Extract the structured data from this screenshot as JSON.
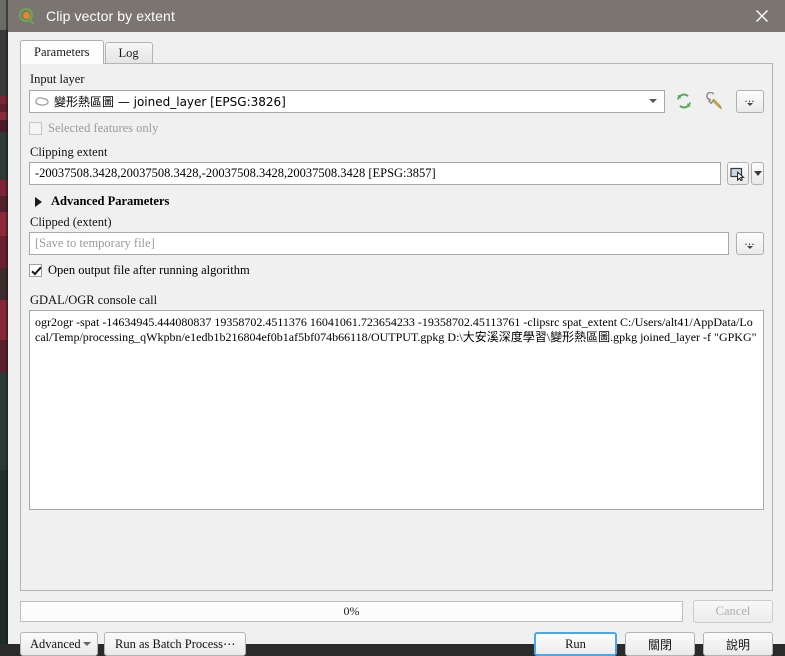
{
  "window": {
    "title": "Clip vector by extent",
    "icon": "qgis-logo-icon",
    "close_label": "✕"
  },
  "tabs": [
    {
      "label": "Parameters",
      "active": true
    },
    {
      "label": "Log",
      "active": false
    }
  ],
  "parameters": {
    "input_layer": {
      "label": "Input layer",
      "value": "變形熱區圖 — joined_layer [EPSG:3826]",
      "layer_icon": "polygon-layer-icon",
      "iterate_icon": "iterate-over-features-icon",
      "expression_icon": "data-defined-override-icon",
      "more_icon": "more-options-icon"
    },
    "selected_features_only": {
      "label": "Selected features only",
      "checked": false,
      "enabled": false
    },
    "clipping_extent": {
      "label": "Clipping extent",
      "value": "-20037508.3428,20037508.3428,-20037508.3428,20037508.3428 [EPSG:3857]",
      "select_extent_icon": "select-extent-on-canvas-icon",
      "dropdown_icon": "chevron-down-icon"
    },
    "advanced_parameters": {
      "label": "Advanced Parameters",
      "expanded": false,
      "toggle_icon": "chevron-right-icon"
    },
    "clipped_output": {
      "label": "Clipped (extent)",
      "value": "",
      "placeholder": "[Save to temporary file]",
      "browse_icon": "more-options-icon"
    },
    "open_output": {
      "label": "Open output file after running algorithm",
      "checked": true,
      "enabled": true
    }
  },
  "console": {
    "label": "GDAL/OGR console call",
    "command": "ogr2ogr -spat -14634945.444080837 19358702.4511376 16041061.723654233 -19358702.45113761 -clipsrc spat_extent C:/Users/alt41/AppData/Local/Temp/processing_qWkpbn/e1edb1b216804ef0b1af5bf074b66118/OUTPUT.gpkg D:\\大安溪深度學習\\變形熱區圖.gpkg joined_layer -f \"GPKG\""
  },
  "footer": {
    "progress_text": "0%",
    "progress_value": 0,
    "cancel_label": "Cancel",
    "advanced_label": "Advanced",
    "batch_label": "Run as Batch Process⋯",
    "run_label": "Run",
    "close_label": "關閉",
    "help_label": "說明"
  },
  "colors": {
    "titlebar": "#7a7571",
    "accent_focus": "#4aa8e8",
    "panel": "#f0f0f0",
    "field": "#ffffff",
    "disabled_text": "#9b9b9b"
  }
}
